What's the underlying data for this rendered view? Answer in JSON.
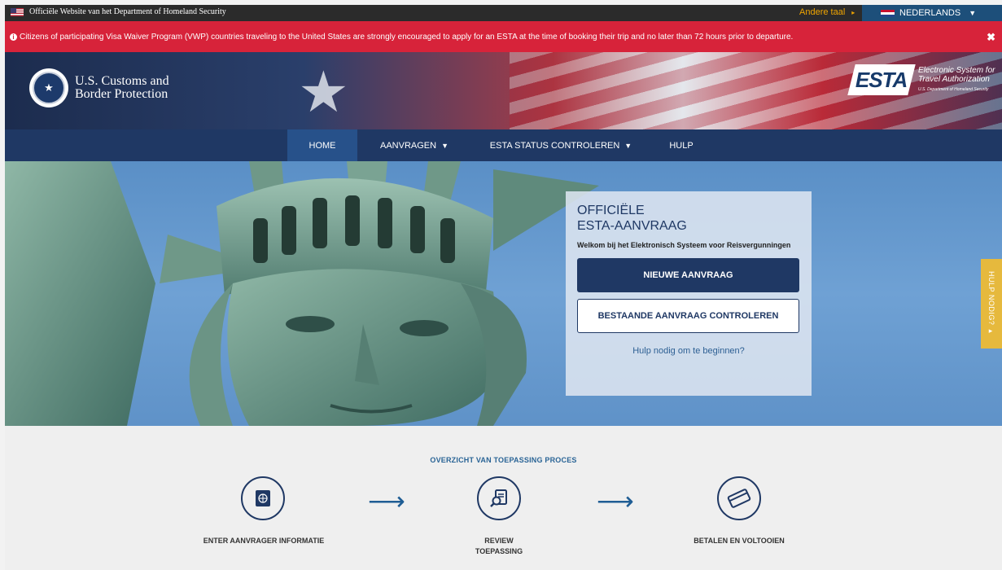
{
  "topbar": {
    "official_text": "Officiële Website van het Department of Homeland Security",
    "other_language": "Andere taal",
    "language": "NEDERLANDS"
  },
  "alert": {
    "message": "Citizens of participating Visa Waiver Program (VWP) countries traveling to the United States are strongly encouraged to apply for an ESTA at the time of booking their trip and no later than 72 hours prior to departure."
  },
  "header": {
    "agency_line1": "U.S. Customs and",
    "agency_line2": "Border Protection",
    "esta_mark": "ESTA",
    "esta_line1": "Electronic System for",
    "esta_line2": "Travel Authorization",
    "esta_sub": "U.S. Department of Homeland Security"
  },
  "nav": {
    "items": [
      {
        "label": "HOME"
      },
      {
        "label": "AANVRAGEN"
      },
      {
        "label": "ESTA STATUS CONTROLEREN"
      },
      {
        "label": "HULP"
      }
    ]
  },
  "card": {
    "title_line1": "OFFICIËLE",
    "title_line2": "ESTA-AANVRAAG",
    "welcome": "Welkom bij het Elektronisch Systeem voor Reisvergunningen",
    "new_application": "NIEUWE AANVRAAG",
    "check_existing": "BESTAANDE AANVRAAG CONTROLEREN",
    "help_link": "Hulp nodig om te beginnen?"
  },
  "help_tab": "HULP NODIG?",
  "process": {
    "title": "OVERZICHT VAN TOEPASSING PROCES",
    "steps": [
      {
        "label": "ENTER AANVRAGER INFORMATIE",
        "icon": "passport-icon"
      },
      {
        "label_line1": "REVIEW",
        "label_line2": "TOEPASSING",
        "icon": "document-search-icon"
      },
      {
        "label": "BETALEN EN VOLTOOIEN",
        "icon": "credit-card-icon"
      }
    ]
  },
  "colors": {
    "navy": "#1f3864",
    "alert_red": "#d7233a",
    "accent_gold": "#e6b93d"
  }
}
